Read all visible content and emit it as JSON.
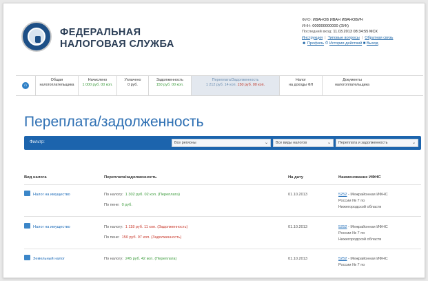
{
  "header": {
    "brand_line1": "ФЕДЕРАЛЬНАЯ",
    "brand_line2": "НАЛОГОВАЯ СЛУЖБА",
    "user": {
      "name_label": "ФИО:",
      "name_value": "ИВАНОВ ИВАН ИВАНОВИЧ",
      "inn_label": "ИНН:",
      "inn_value": "000000000000 (ЗУК)",
      "last_login_label": "Последний вход:",
      "last_login_value": "11.03.2013 08:34:55 МСК",
      "links_row1": [
        "Инструкция",
        "Типовые вопросы",
        "Обратная связь"
      ],
      "links_row2": [
        "Профиль",
        "История действий",
        "Выход"
      ]
    }
  },
  "tabs": [
    {
      "top": "Общая",
      "bottom": "налогоплательщика"
    },
    {
      "top": "Начислено",
      "bottom": "1 000 руб. 00 коп."
    },
    {
      "top": "Уплачено",
      "bottom": "0 руб."
    },
    {
      "top": "Задолженность",
      "bottom": "150 руб. 00 коп."
    },
    {
      "top": "Переплата/Задолженность",
      "bottom_over": "1 212 руб. 14 коп.",
      "bottom_debt": "150 руб. 00 коп."
    },
    {
      "top": "Налог",
      "bottom": "на доходы ФЛ"
    },
    {
      "top": "Документы",
      "bottom": "налогоплательщика"
    }
  ],
  "page_title": "Переплата/задолженность",
  "filter": {
    "label": "Фильтр:",
    "select1": "Все регионы",
    "select2": "Все виды налогов",
    "select3": "Переплата и задолженность"
  },
  "table": {
    "headers": [
      "Вид налога",
      "Переплата/задолженность",
      "На дату",
      "Наименование ИФНС"
    ],
    "rows": [
      {
        "tax": "Налог на имущество",
        "lines": [
          {
            "label": "По налогу:",
            "value": "1 302 руб. 02 коп. (Переплата)",
            "kind": "over"
          },
          {
            "label": "По пене:",
            "value": "0 руб.",
            "kind": "over"
          }
        ],
        "date": "01.10.2013",
        "inspection": {
          "code": "5252",
          "text1": " - Межрайонная ИФНС",
          "text2": "России № 7 по",
          "text3": "Нижегородской области"
        }
      },
      {
        "tax": "Налог на имущество",
        "lines": [
          {
            "label": "По налогу:",
            "value": "1 118 руб. 11 коп. (Задолженность)",
            "kind": "debt"
          },
          {
            "label": "По пене:",
            "value": "150 руб. 97 коп. (Задолженность)",
            "kind": "debt"
          }
        ],
        "date": "01.10.2013",
        "inspection": {
          "code": "5252",
          "text1": " - Межрайонная ИФНС",
          "text2": "России № 7 по",
          "text3": "Нижегородской области"
        }
      },
      {
        "tax": "Земельный налог",
        "lines": [
          {
            "label": "По налогу:",
            "value": "245 руб. 42 коп. (Переплата)",
            "kind": "over"
          }
        ],
        "date": "01.10.2013",
        "inspection": {
          "code": "5252",
          "text1": " - Межрайонная ИФНС",
          "text2": "России № 7 по",
          "text3": ""
        }
      }
    ]
  }
}
